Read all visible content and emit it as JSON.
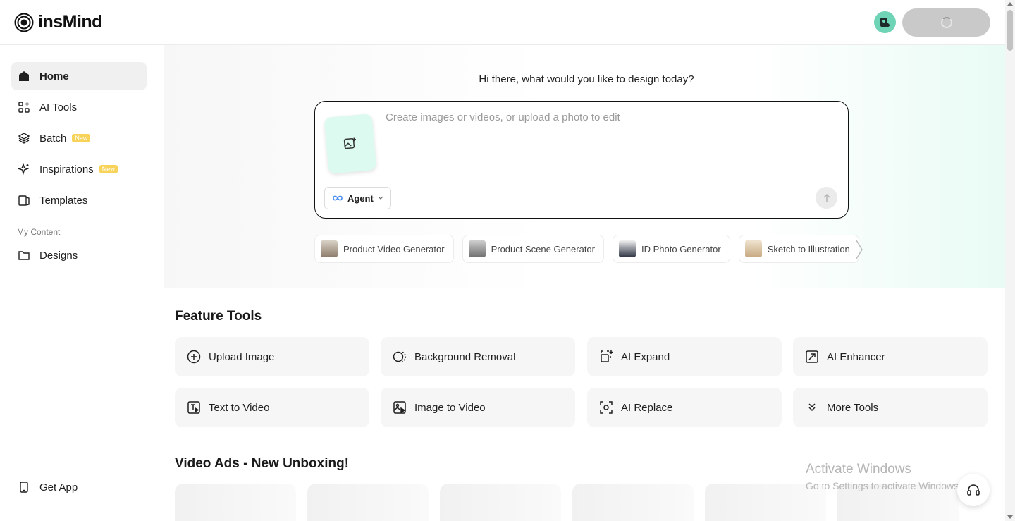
{
  "header": {
    "brand": "insMind"
  },
  "sidebar": {
    "items": [
      {
        "label": "Home",
        "icon": "home-icon"
      },
      {
        "label": "AI Tools",
        "icon": "grid-plus-icon"
      },
      {
        "label": "Batch",
        "icon": "layers-icon",
        "badge": "New"
      },
      {
        "label": "Inspirations",
        "icon": "sparkle-icon",
        "badge": "New"
      },
      {
        "label": "Templates",
        "icon": "template-icon"
      }
    ],
    "section_label": "My Content",
    "designs_label": "Designs",
    "get_app_label": "Get App"
  },
  "hero": {
    "greeting": "Hi there, what would you like to design today?",
    "prompt_placeholder": "Create images or videos, or upload a photo to edit",
    "agent_label": "Agent",
    "chips": [
      "Product Video Generator",
      "Product Scene Generator",
      "ID Photo Generator",
      "Sketch to Illustration"
    ]
  },
  "feature_tools": {
    "title": "Feature Tools",
    "items": [
      {
        "label": "Upload Image",
        "icon": "plus-circle-icon"
      },
      {
        "label": "Background Removal",
        "icon": "background-removal-icon"
      },
      {
        "label": "AI Expand",
        "icon": "expand-icon"
      },
      {
        "label": "AI Enhancer",
        "icon": "enhance-icon"
      },
      {
        "label": "Text to Video",
        "icon": "text-video-icon"
      },
      {
        "label": "Image to Video",
        "icon": "image-video-icon"
      },
      {
        "label": "AI Replace",
        "icon": "replace-icon"
      },
      {
        "label": "More Tools",
        "icon": "chevrons-down-icon"
      }
    ]
  },
  "video_ads": {
    "title": "Video Ads - New Unboxing!"
  },
  "watermark": {
    "title": "Activate Windows",
    "subtitle": "Go to Settings to activate Windows."
  },
  "colors": {
    "accent_mint": "#ddfaf1",
    "badge_yellow": "#f8d35a",
    "avatar_green": "#6fd3b5"
  }
}
